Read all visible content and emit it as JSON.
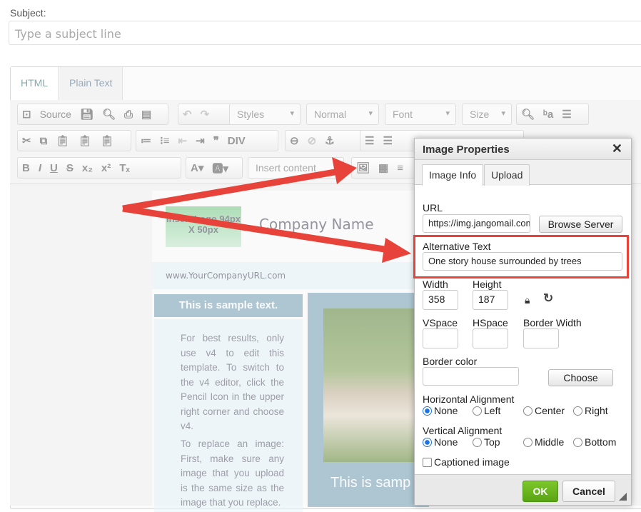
{
  "subject": {
    "label": "Subject:",
    "placeholder": "Type a subject line"
  },
  "editor_tabs": [
    "HTML",
    "Plain Text"
  ],
  "toolbar": {
    "source": "Source",
    "styles": "Styles",
    "format": "Normal",
    "font": "Font",
    "size": "Size",
    "insert_content": "Insert content"
  },
  "template": {
    "logo_text": "Insert Logo 94px X 50px",
    "company_name": "Company Name",
    "url": "www.YourCompanyURL.com",
    "sample_heading": "This is sample text.",
    "sample_heading_2": "This is samp",
    "bullets": [
      {
        "bold_lead": "",
        "text": "For best results, only use v4 to edit this template. To switch to the v4 editor, click the Pencil Icon in the upper right corner and choose v4."
      },
      {
        "text": "To replace an image: First, make sure any image that you upload is the same size as the image that you replace."
      }
    ]
  },
  "dialog": {
    "title": "Image Properties",
    "tabs": [
      "Image Info",
      "Upload"
    ],
    "url_label": "URL",
    "url_value": "https://img.jangomail.com",
    "browse": "Browse Server",
    "alt_label": "Alternative Text",
    "alt_value": "One story house surrounded by trees",
    "width_label": "Width",
    "width_value": "358",
    "height_label": "Height",
    "height_value": "187",
    "vspace": "VSpace",
    "hspace": "HSpace",
    "border_width": "Border Width",
    "border_color": "Border color",
    "choose": "Choose",
    "h_align_label": "Horizontal Alignment",
    "h_align": [
      "None",
      "Left",
      "Center",
      "Right"
    ],
    "v_align_label": "Vertical Alignment",
    "v_align": [
      "None",
      "Top",
      "Middle",
      "Bottom"
    ],
    "captioned": "Captioned image",
    "ok": "OK",
    "cancel": "Cancel"
  },
  "colors": {
    "annotation": "#e8433a",
    "ok_green": "#6cb81e",
    "template_blue": "#7fa8bd"
  }
}
